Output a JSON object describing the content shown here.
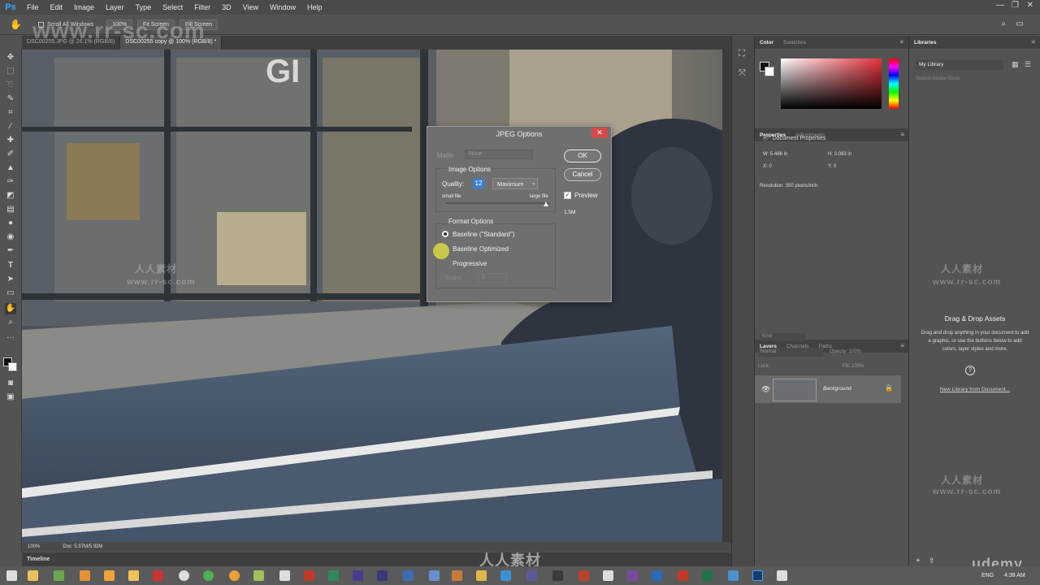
{
  "app": {
    "logo": "Ps"
  },
  "menu": [
    "File",
    "Edit",
    "Image",
    "Layer",
    "Type",
    "Select",
    "Filter",
    "3D",
    "View",
    "Window",
    "Help"
  ],
  "options_bar": {
    "scroll_all": "Scroll All Windows",
    "zoom": "100%",
    "fit_screen": "Fit Screen",
    "fill_screen": "Fill Screen"
  },
  "tabs": [
    "DSC00255.JPG @ 26.1% (RGB/8)",
    "DSC00255 copy @ 100% (RGB/8) *"
  ],
  "status": {
    "zoom": "100%",
    "doc": "Doc: 5.97M/5.93M"
  },
  "timeline": "Timeline",
  "dialog": {
    "title": "JPEG Options",
    "matte_label": "Matte:",
    "matte_value": "None",
    "image_options": "Image Options",
    "quality_label": "Quality:",
    "quality_value": "12",
    "quality_preset": "Maximum",
    "small_file": "small file",
    "large_file": "large file",
    "quality_fraction": 1.0,
    "format_options": "Format Options",
    "baseline_standard": "Baseline (\"Standard\")",
    "baseline_optimized": "Baseline Optimized",
    "progressive": "Progressive",
    "scans_label": "Scans:",
    "scans_value": "3",
    "ok": "OK",
    "cancel": "Cancel",
    "preview": "Preview",
    "size": "1.5M"
  },
  "color_panel": {
    "tab_color": "Color",
    "tab_swatches": "Swatches"
  },
  "properties": {
    "tab_properties": "Properties",
    "tab_adjustments": "Adjustments",
    "doc_props": "Document Properties",
    "w": "W: 5.486 in",
    "h": "H: 3.083 in",
    "x": "X: 0",
    "y": "Y: 0",
    "resolution": "Resolution: 350 pixels/inch"
  },
  "layers": {
    "tab_layers": "Layers",
    "tab_channels": "Channels",
    "tab_paths": "Paths",
    "kind": "Kind",
    "blend": "Normal",
    "opacity": "Opacity: 100%",
    "lock": "Lock:",
    "fill": "Fill: 100%",
    "layer_name": "Background"
  },
  "libraries": {
    "title": "Libraries",
    "library": "My Library",
    "search": "Search Adobe Stock",
    "drag_title": "Drag & Drop Assets",
    "drag_text": "Drag and drop anything in your document to add a graphic, or use the buttons below to add colors, layer styles and more.",
    "new_library": "New Library from Document..."
  },
  "taskbar": {
    "lang": "ENG",
    "time": "4:38 AM"
  },
  "watermarks": {
    "cn": "人人素材",
    "url": "www.rr-sc.com",
    "brand": "udemy"
  }
}
